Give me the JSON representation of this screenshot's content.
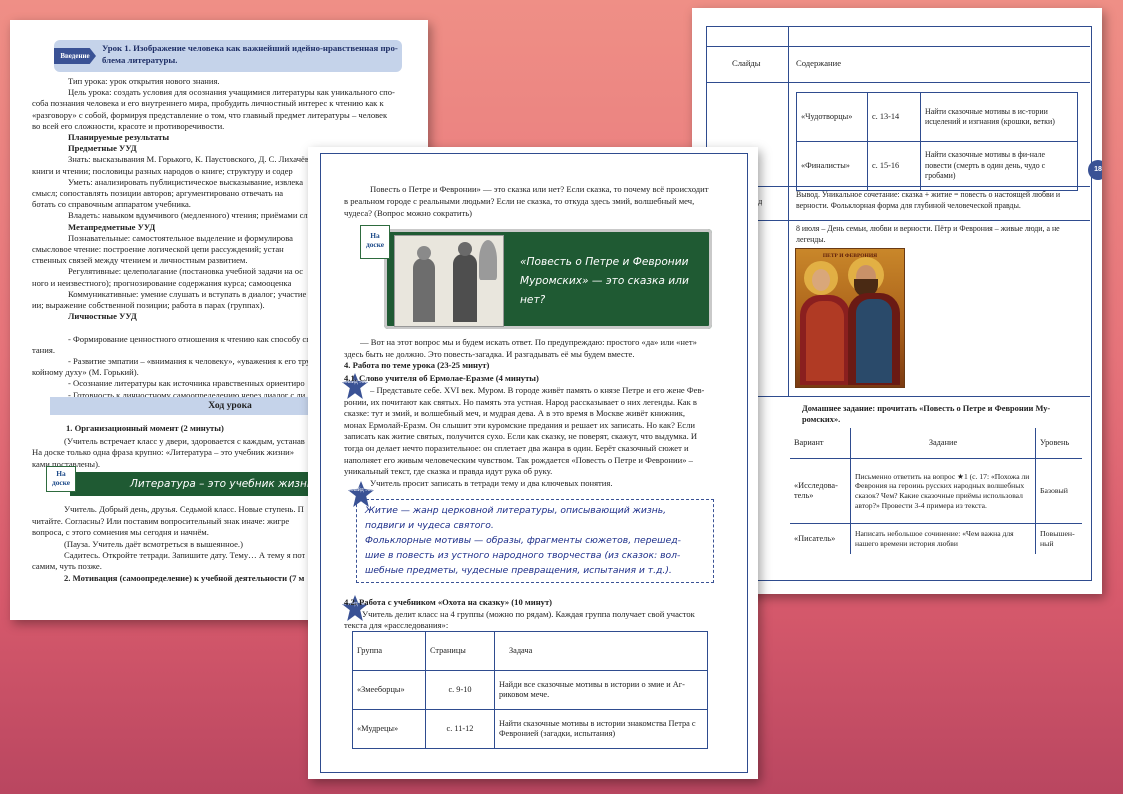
{
  "page1": {
    "tag": "Введение",
    "lesson_title_1": "Урок 1. Изображение человека как важнейший идейно-нравственная про-",
    "lesson_title_2": "блема литературы.",
    "lines": [
      "Тип урока: урок открытия нового знания.",
      "Цель урока: создать условия для осознания учащимися литературы как уникального спо-",
      "соба познания человека и его внутреннего мира, пробудить личностный интерес к чтению как к",
      "«разговору» с собой, формируя представление о том, что главный предмет литературы – человек",
      "во всей его сложности, красоте и противоречивости.",
      "Планируемые результаты",
      "Предметные УУД",
      "Знать: высказывания М. Горького, К. Паустовского, Д. С. Лихачёв",
      "книги и чтении; пословицы разных народов о книге; структуру и содер",
      "Уметь: анализировать публицистическое высказывание, извлека",
      "смысл; сопоставлять позиции авторов; аргументировано отвечать на",
      "ботать со справочным аппаратом учебника.",
      "Владеть: навыком вдумчивого (медленного) чтения; приёмами сл",
      "Метапредметные УУД",
      "Познавательные: самостоятельное выделение и формулирова",
      "смысловое чтение: построение логической цепи рассуждений; устан",
      "ственных связей между чтением и личностным развитием.",
      "Регулятивные: целеполагание (постановка учебной задачи на ос",
      "ного и неизвестного); прогнозирование содержания курса; самооценка",
      "Коммуникативные: умение слушать и вступать в диалог; участие",
      "ии; выражение собственной позиции; работа в парах (группах).",
      "Личностные УУД",
      "",
      "- Формирование ценностного отношения к чтению как способу сп",
      "тания.",
      "- Развитие эмпатии – «внимания к человеку», «уважения к его тру",
      "койному духу» (М. Горький).",
      "- Осознание литературы как источника нравственных ориентиро",
      "- Готовность к личностному самоопределению через диалог с ли"
    ],
    "section_heading": "Ход урока",
    "org_heading": "1. Организационный момент (2 минуты)",
    "org_lines": [
      "(Учитель встречает класс у двери, здоровается с каждым, устанав",
      "На доске только одна фраза крупно: «Литература – это учебник жизни»",
      "ками поставлены).",
      "",
      "",
      "",
      "Учитель. Добрый день, друзья. Седьмой класс. Новые ступень. П",
      "читайте. Согласны? Или поставим вопросительный знак иначе: жигре",
      "вопроса, с этого сомнения мы сегодня и начнём.",
      "(Пауза. Учитель даёт всмотреться в вышеянное.)",
      "Садитесь. Откройте тетради. Запишите дату. Тему… А тему я пот",
      "самим, чуть позже.",
      "2. Мотивация (самоопределение) к учебной деятельности (7 м"
    ],
    "board_label": "На доске",
    "board_text": "Литература – это учебник жизни?"
  },
  "page2": {
    "intro_lines": [
      "Повесть о Петре и Февронии» — это сказка или нет? Если сказка, то почему всё происходит",
      "в реальном городе с реальными людьми? Если не сказка, то откуда здесь змий, волшебный меч,",
      "чудеса? (Вопрос можно сократить)"
    ],
    "board_label": "На доске",
    "board_text": "«Повесть о Петре и Февронии Муромских» — это сказка или нет?",
    "after_lines": [
      "— Вот на этот вопрос мы и будем искать ответ. По предупреждаю: простого «да» или «нет»",
      "здесь быть не должно. Это повесть-загадка. И разгадывать её мы будем вместе."
    ],
    "work_heading": "4. Работа по теме урока (23-25 минут)",
    "teacher_heading": "4.1. Слово учителя об Ермолае-Еразме (4 минуты)",
    "slide2": "Слайд №2",
    "teacher_lines": [
      "– Представьте себе. XVI век. Муром. В городе живёт память о князе Петре и его жене Фев-",
      "ронии, их почитают как святых. Но память эта устная. Народ рассказывает о них легенды. Как в",
      "сказке: тут и змий, и волшебный меч, и мудрая дева. А в это время в Москве живёт книжник,",
      "монах Ермолай-Еразм. Он слышит эти куромские предания и решает их записать. Но как? Если",
      "записать как житие святых, получится сухо. Если как сказку, не поверят, скажут, что выдумка. И",
      "тогда он делает нечто поразительное: он сплетает два жанра в один. Берёт сказочный сюжет и",
      "наполняет его живым человеческим чувством. Так рождается «Повесть о Петре и Февронии» –",
      "уникальный текст, где сказка и правда идут рука об руку.",
      "Учитель просит записать в тетради тему и два ключевых понятия."
    ],
    "slide3": "Слайд №3",
    "hand_lines": [
      "Житие — жанр церковной литературы, описывающий жизнь,",
      "подвиги и чудеса святого.",
      "Фольклорные мотивы — образы, фрагменты сюжетов, перешед-",
      "шие в повесть из устного народного творчества (из сказок: вол-",
      "шебные предметы, чудесные превращения, испытания и т.д.)."
    ],
    "textbook_heading": "4.2. Работа с учебником «Охота на сказку» (10 минут)",
    "slide4": "Слайд №4",
    "textbook_lines": [
      "Учитель делит класс на 4 группы (можно по рядам). Каждая группа получает свой участок",
      "текста для «расследования»:"
    ],
    "table": {
      "headers": [
        "Группа",
        "Страницы",
        "Задача"
      ],
      "rows": [
        [
          "«Змееборцы»",
          "с. 9-10",
          "Найди все сказочные мотивы в истории о змие и Аг-риковом мече."
        ],
        [
          "«Мудрецы»",
          "с. 11-12",
          "Найти сказочные мотивы в истории знакомства Петра с Февронией (загадки, испытания)"
        ]
      ]
    }
  },
  "page3": {
    "col1": "Слайды",
    "col2": "Содержание",
    "inner_rows": [
      [
        "«Чудотворцы»",
        "с. 13-14",
        "Найти сказочные мотивы в ис-тории исцелений и изгнания (крошки, ветки)"
      ],
      [
        "«Финалисты»",
        "с. 15-16",
        "Найти сказочные мотивы в фи-нале повести (смерть в один день, чудо с гробами)"
      ]
    ],
    "side_fragment": "д",
    "conclusion": "Вывод. Уникальное сочетание: сказка + житие = повесть о настоящей любви и верности. Фольклорная форма для глубиной человеческой правды.",
    "july": "8 июля – День семьи, любви и верности. Пётр и Феврония – живые люди, а не легенды.",
    "icon_title": "ПЕТР И ФЕВРОНИЯ",
    "homework": "Домашнее задание: прочитать «Повесть о Петре и Февронии Му-ромских».",
    "hw_table": {
      "headers": [
        "Вариант",
        "Задание",
        "Уровень"
      ],
      "rows": [
        [
          "«Исследова-тель»",
          "Письменно ответить на вопрос ★1 (с. 17: «Похожа ли Феврония на героинь русских народных волшебных сказок? Чем? Какие сказочные приёмы использовал автор?» Провести 3-4 примера из текста.",
          "Базовый"
        ],
        [
          "«Писатель»",
          "Написать небольшое сочинение: «Чем важна для нашего времени история любви",
          "Повышен-ный"
        ]
      ]
    },
    "page_num_14": "14",
    "page_num_18": "18"
  }
}
